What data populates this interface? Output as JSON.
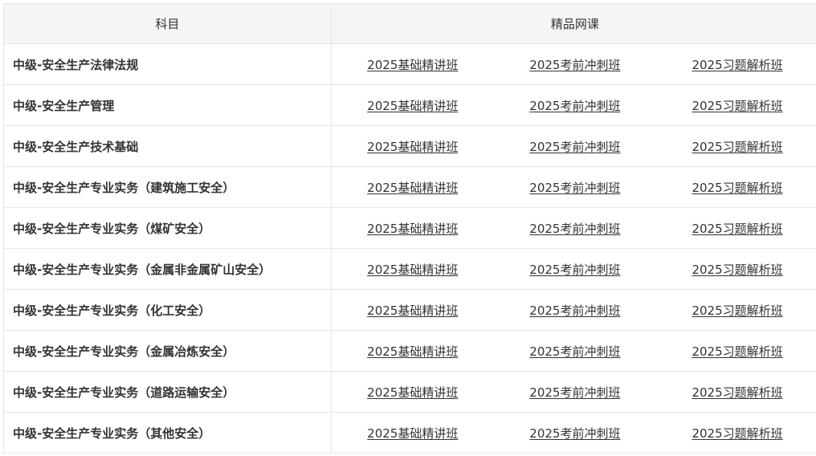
{
  "table": {
    "header": {
      "subject": "科目",
      "courses": "精品网课"
    },
    "rows": [
      {
        "subject": "中级-安全生产法律法规",
        "links": [
          "2025基础精讲班",
          "2025考前冲刺班",
          "2025习题解析班"
        ]
      },
      {
        "subject": "中级-安全生产管理",
        "links": [
          "2025基础精讲班",
          "2025考前冲刺班",
          "2025习题解析班"
        ]
      },
      {
        "subject": "中级-安全生产技术基础",
        "links": [
          "2025基础精讲班",
          "2025考前冲刺班",
          "2025习题解析班"
        ]
      },
      {
        "subject": "中级-安全生产专业实务（建筑施工安全）",
        "links": [
          "2025基础精讲班",
          "2025考前冲刺班",
          "2025习题解析班"
        ]
      },
      {
        "subject": "中级-安全生产专业实务（煤矿安全）",
        "links": [
          "2025基础精讲班",
          "2025考前冲刺班",
          "2025习题解析班"
        ]
      },
      {
        "subject": "中级-安全生产专业实务（金属非金属矿山安全）",
        "links": [
          "2025基础精讲班",
          "2025考前冲刺班",
          "2025习题解析班"
        ]
      },
      {
        "subject": "中级-安全生产专业实务（化工安全）",
        "links": [
          "2025基础精讲班",
          "2025考前冲刺班",
          "2025习题解析班"
        ]
      },
      {
        "subject": "中级-安全生产专业实务（金属冶炼安全）",
        "links": [
          "2025基础精讲班",
          "2025考前冲刺班",
          "2025习题解析班"
        ]
      },
      {
        "subject": "中级-安全生产专业实务（道路运输安全）",
        "links": [
          "2025基础精讲班",
          "2025考前冲刺班",
          "2025习题解析班"
        ]
      },
      {
        "subject": "中级-安全生产专业实务（其他安全）",
        "links": [
          "2025基础精讲班",
          "2025考前冲刺班",
          "2025习题解析班"
        ]
      }
    ]
  }
}
